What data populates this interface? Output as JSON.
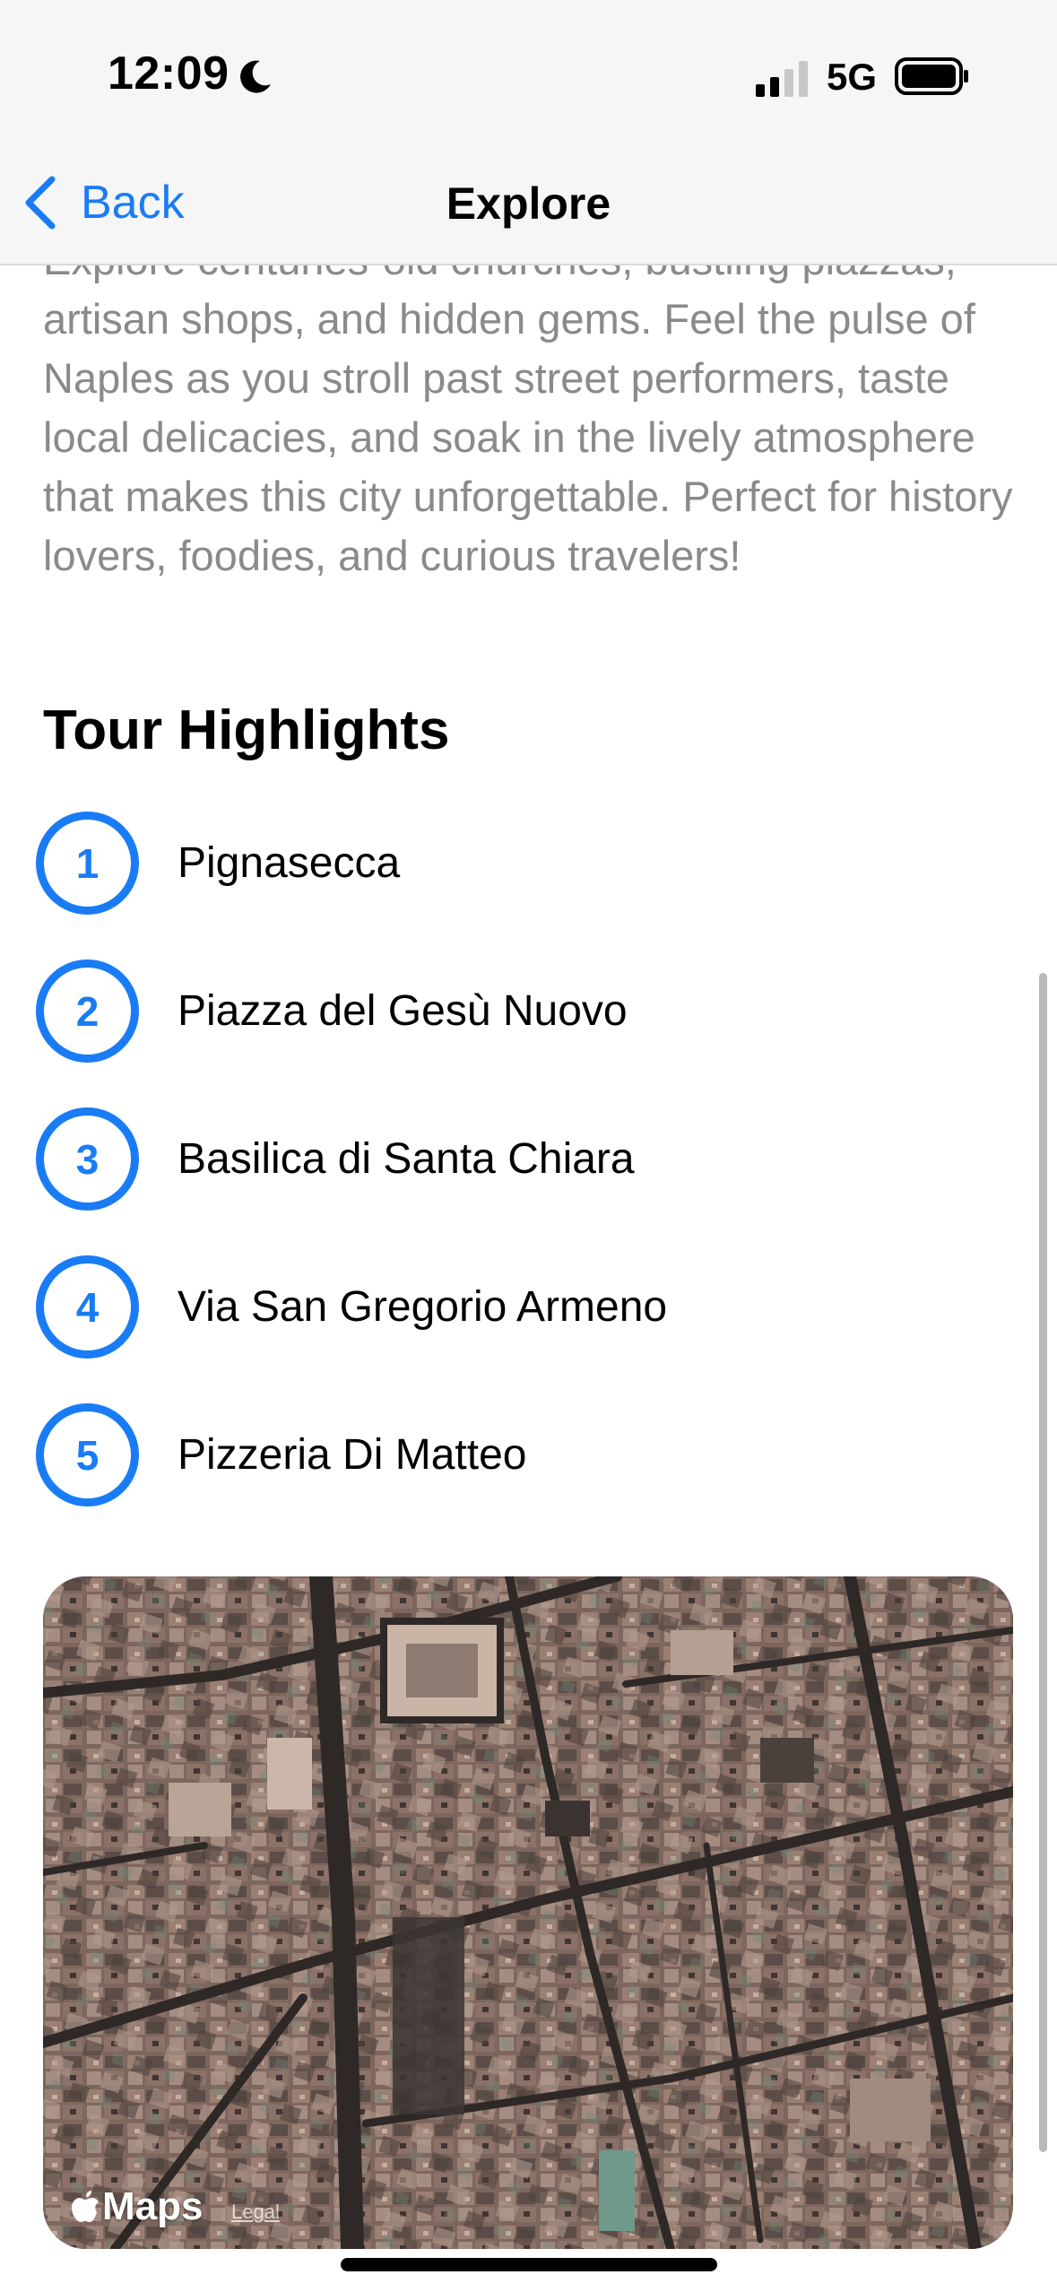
{
  "status_bar": {
    "time": "12:09",
    "network": "5G"
  },
  "nav": {
    "back_label": "Back",
    "title": "Explore"
  },
  "description": "Explore centuries-old churches, bustling piazzas, artisan shops, and hidden gems. Feel the pulse of Naples as you stroll past street performers, taste local delicacies, and soak in the lively atmosphere that makes this city unforgettable. Perfect for history lovers, foodies, and curious travelers!",
  "highlights": {
    "title": "Tour Highlights",
    "items": [
      {
        "number": "1",
        "name": "Pignasecca"
      },
      {
        "number": "2",
        "name": "Piazza del Gesù Nuovo"
      },
      {
        "number": "3",
        "name": "Basilica di Santa Chiara"
      },
      {
        "number": "4",
        "name": "Via San Gregorio Armeno"
      },
      {
        "number": "5",
        "name": "Pizzeria Di Matteo"
      }
    ]
  },
  "map": {
    "brand_label": "Maps",
    "legal_label": "Legal"
  },
  "colors": {
    "accent": "#1a7cf5",
    "secondary_text": "#8a8a8e"
  }
}
